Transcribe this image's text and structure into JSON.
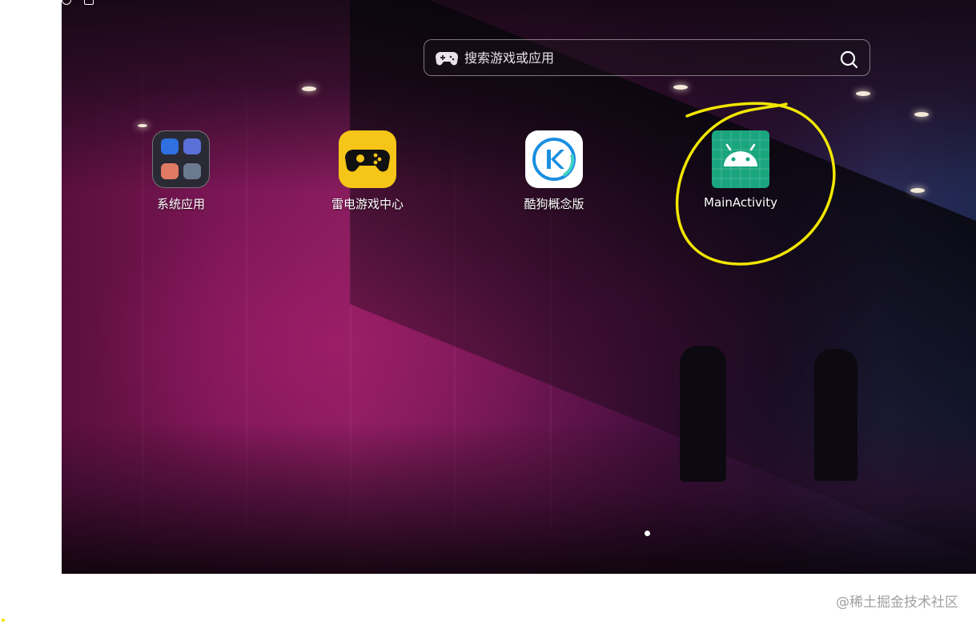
{
  "search": {
    "placeholder": "搜索游戏或应用"
  },
  "apps": [
    {
      "label": "系统应用"
    },
    {
      "label": "雷电游戏中心"
    },
    {
      "label": "酷狗概念版"
    },
    {
      "label": "MainActivity"
    }
  ],
  "pager": {
    "current_page": 1,
    "total_pages": 1
  },
  "watermark": "@稀土掘金技术社区",
  "colors": {
    "annotation": "#f2e600",
    "leidian": "#f5c518",
    "android": "#1aa57f",
    "kugou": "#1a8fe0"
  }
}
